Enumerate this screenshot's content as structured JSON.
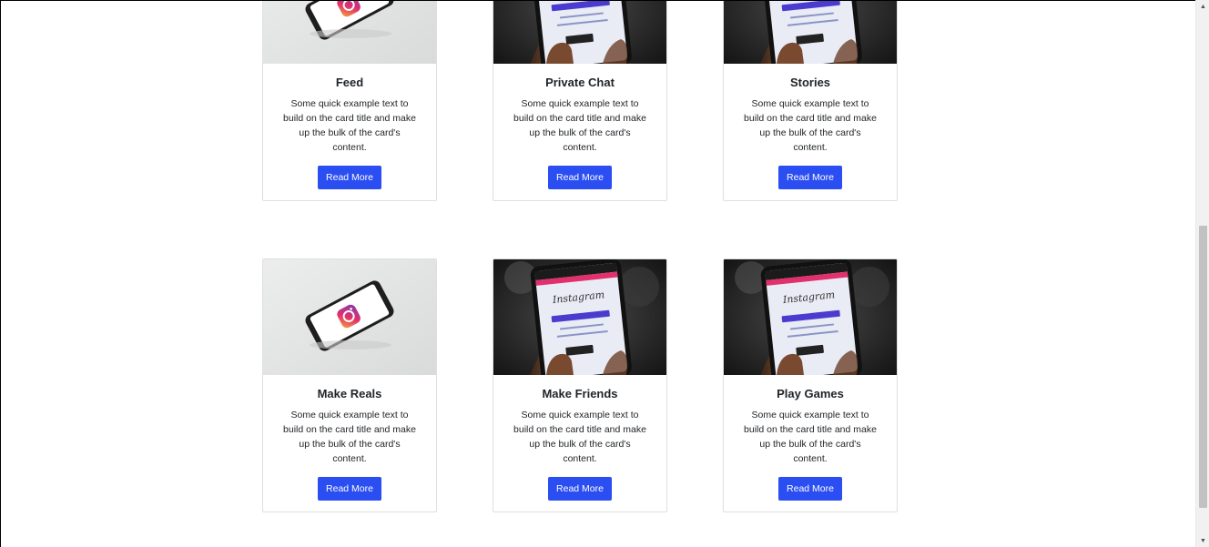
{
  "cards": [
    {
      "title": "Feed",
      "text": "Some quick example text to build on the card title and make up the bulk of the card's content.",
      "button_label": "Read More",
      "image_icon": "instagram-phone-on-table-image"
    },
    {
      "title": "Private Chat",
      "text": "Some quick example text to build on the card title and make up the bulk of the card's content.",
      "button_label": "Read More",
      "image_icon": "hand-holding-phone-instagram-image"
    },
    {
      "title": "Stories",
      "text": "Some quick example text to build on the card title and make up the bulk of the card's content.",
      "button_label": "Read More",
      "image_icon": "hand-holding-phone-instagram-image"
    },
    {
      "title": "Make Reals",
      "text": "Some quick example text to build on the card title and make up the bulk of the card's content.",
      "button_label": "Read More",
      "image_icon": "instagram-phone-on-table-image"
    },
    {
      "title": "Make Friends",
      "text": "Some quick example text to build on the card title and make up the bulk of the card's content.",
      "button_label": "Read More",
      "image_icon": "hand-holding-phone-instagram-image"
    },
    {
      "title": "Play Games",
      "text": "Some quick example text to build on the card title and make up the bulk of the card's content.",
      "button_label": "Read More",
      "image_icon": "hand-holding-phone-instagram-image"
    }
  ],
  "theme": {
    "button_color": "#2b4ef2",
    "card_border": "#dfdfdf"
  },
  "scrollbar": {
    "up_icon": "scroll-up-arrow-icon",
    "down_icon": "scroll-down-arrow-icon"
  }
}
